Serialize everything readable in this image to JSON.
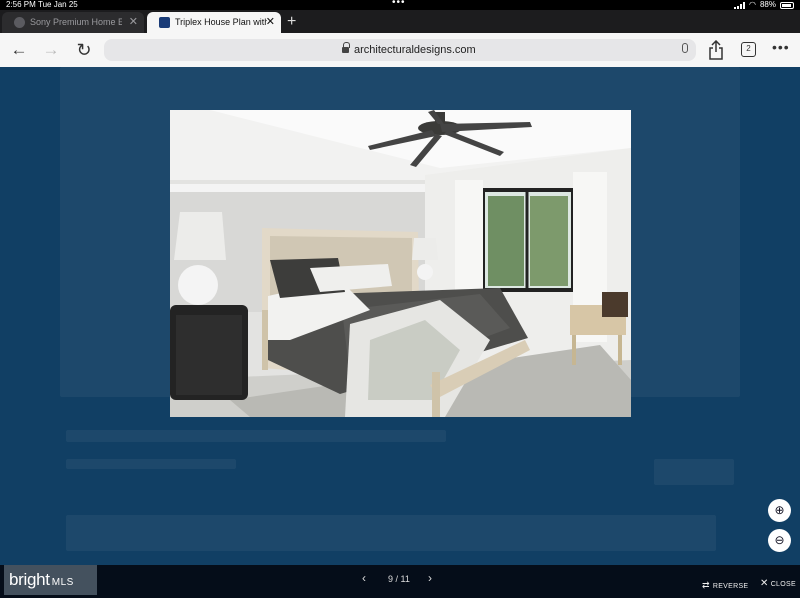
{
  "status_bar": {
    "time": "2:56 PM",
    "date": "Tue Jan 25",
    "battery": "88%",
    "battery_level": 0.88
  },
  "tabs": [
    {
      "title": "Sony Premium Home Ent",
      "active": false
    },
    {
      "title": "Triplex House Plan with I",
      "active": true
    }
  ],
  "toolbar": {
    "url": "architecturaldesigns.com",
    "tab_count": "2"
  },
  "viewer": {
    "image_alt": "Bedroom rendering",
    "counter": "9 / 11",
    "reverse_label": "REVERSE",
    "close_label": "CLOSE",
    "logo_text": "bright",
    "logo_suffix": "MLS"
  },
  "colors": {
    "overlay_background": "#113f64",
    "bottom_bar": "#050d19"
  }
}
